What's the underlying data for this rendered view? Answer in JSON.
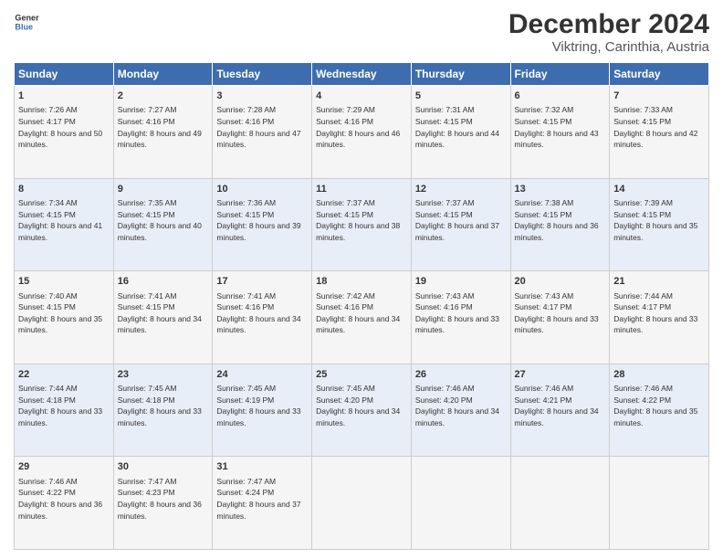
{
  "header": {
    "logo_line1": "General",
    "logo_line2": "Blue",
    "title": "December 2024",
    "subtitle": "Viktring, Carinthia, Austria"
  },
  "days_of_week": [
    "Sunday",
    "Monday",
    "Tuesday",
    "Wednesday",
    "Thursday",
    "Friday",
    "Saturday"
  ],
  "weeks": [
    [
      {
        "day": "1",
        "sunrise": "Sunrise: 7:26 AM",
        "sunset": "Sunset: 4:17 PM",
        "daylight": "Daylight: 8 hours and 50 minutes."
      },
      {
        "day": "2",
        "sunrise": "Sunrise: 7:27 AM",
        "sunset": "Sunset: 4:16 PM",
        "daylight": "Daylight: 8 hours and 49 minutes."
      },
      {
        "day": "3",
        "sunrise": "Sunrise: 7:28 AM",
        "sunset": "Sunset: 4:16 PM",
        "daylight": "Daylight: 8 hours and 47 minutes."
      },
      {
        "day": "4",
        "sunrise": "Sunrise: 7:29 AM",
        "sunset": "Sunset: 4:16 PM",
        "daylight": "Daylight: 8 hours and 46 minutes."
      },
      {
        "day": "5",
        "sunrise": "Sunrise: 7:31 AM",
        "sunset": "Sunset: 4:15 PM",
        "daylight": "Daylight: 8 hours and 44 minutes."
      },
      {
        "day": "6",
        "sunrise": "Sunrise: 7:32 AM",
        "sunset": "Sunset: 4:15 PM",
        "daylight": "Daylight: 8 hours and 43 minutes."
      },
      {
        "day": "7",
        "sunrise": "Sunrise: 7:33 AM",
        "sunset": "Sunset: 4:15 PM",
        "daylight": "Daylight: 8 hours and 42 minutes."
      }
    ],
    [
      {
        "day": "8",
        "sunrise": "Sunrise: 7:34 AM",
        "sunset": "Sunset: 4:15 PM",
        "daylight": "Daylight: 8 hours and 41 minutes."
      },
      {
        "day": "9",
        "sunrise": "Sunrise: 7:35 AM",
        "sunset": "Sunset: 4:15 PM",
        "daylight": "Daylight: 8 hours and 40 minutes."
      },
      {
        "day": "10",
        "sunrise": "Sunrise: 7:36 AM",
        "sunset": "Sunset: 4:15 PM",
        "daylight": "Daylight: 8 hours and 39 minutes."
      },
      {
        "day": "11",
        "sunrise": "Sunrise: 7:37 AM",
        "sunset": "Sunset: 4:15 PM",
        "daylight": "Daylight: 8 hours and 38 minutes."
      },
      {
        "day": "12",
        "sunrise": "Sunrise: 7:37 AM",
        "sunset": "Sunset: 4:15 PM",
        "daylight": "Daylight: 8 hours and 37 minutes."
      },
      {
        "day": "13",
        "sunrise": "Sunrise: 7:38 AM",
        "sunset": "Sunset: 4:15 PM",
        "daylight": "Daylight: 8 hours and 36 minutes."
      },
      {
        "day": "14",
        "sunrise": "Sunrise: 7:39 AM",
        "sunset": "Sunset: 4:15 PM",
        "daylight": "Daylight: 8 hours and 35 minutes."
      }
    ],
    [
      {
        "day": "15",
        "sunrise": "Sunrise: 7:40 AM",
        "sunset": "Sunset: 4:15 PM",
        "daylight": "Daylight: 8 hours and 35 minutes."
      },
      {
        "day": "16",
        "sunrise": "Sunrise: 7:41 AM",
        "sunset": "Sunset: 4:15 PM",
        "daylight": "Daylight: 8 hours and 34 minutes."
      },
      {
        "day": "17",
        "sunrise": "Sunrise: 7:41 AM",
        "sunset": "Sunset: 4:16 PM",
        "daylight": "Daylight: 8 hours and 34 minutes."
      },
      {
        "day": "18",
        "sunrise": "Sunrise: 7:42 AM",
        "sunset": "Sunset: 4:16 PM",
        "daylight": "Daylight: 8 hours and 34 minutes."
      },
      {
        "day": "19",
        "sunrise": "Sunrise: 7:43 AM",
        "sunset": "Sunset: 4:16 PM",
        "daylight": "Daylight: 8 hours and 33 minutes."
      },
      {
        "day": "20",
        "sunrise": "Sunrise: 7:43 AM",
        "sunset": "Sunset: 4:17 PM",
        "daylight": "Daylight: 8 hours and 33 minutes."
      },
      {
        "day": "21",
        "sunrise": "Sunrise: 7:44 AM",
        "sunset": "Sunset: 4:17 PM",
        "daylight": "Daylight: 8 hours and 33 minutes."
      }
    ],
    [
      {
        "day": "22",
        "sunrise": "Sunrise: 7:44 AM",
        "sunset": "Sunset: 4:18 PM",
        "daylight": "Daylight: 8 hours and 33 minutes."
      },
      {
        "day": "23",
        "sunrise": "Sunrise: 7:45 AM",
        "sunset": "Sunset: 4:18 PM",
        "daylight": "Daylight: 8 hours and 33 minutes."
      },
      {
        "day": "24",
        "sunrise": "Sunrise: 7:45 AM",
        "sunset": "Sunset: 4:19 PM",
        "daylight": "Daylight: 8 hours and 33 minutes."
      },
      {
        "day": "25",
        "sunrise": "Sunrise: 7:45 AM",
        "sunset": "Sunset: 4:20 PM",
        "daylight": "Daylight: 8 hours and 34 minutes."
      },
      {
        "day": "26",
        "sunrise": "Sunrise: 7:46 AM",
        "sunset": "Sunset: 4:20 PM",
        "daylight": "Daylight: 8 hours and 34 minutes."
      },
      {
        "day": "27",
        "sunrise": "Sunrise: 7:46 AM",
        "sunset": "Sunset: 4:21 PM",
        "daylight": "Daylight: 8 hours and 34 minutes."
      },
      {
        "day": "28",
        "sunrise": "Sunrise: 7:46 AM",
        "sunset": "Sunset: 4:22 PM",
        "daylight": "Daylight: 8 hours and 35 minutes."
      }
    ],
    [
      {
        "day": "29",
        "sunrise": "Sunrise: 7:46 AM",
        "sunset": "Sunset: 4:22 PM",
        "daylight": "Daylight: 8 hours and 36 minutes."
      },
      {
        "day": "30",
        "sunrise": "Sunrise: 7:47 AM",
        "sunset": "Sunset: 4:23 PM",
        "daylight": "Daylight: 8 hours and 36 minutes."
      },
      {
        "day": "31",
        "sunrise": "Sunrise: 7:47 AM",
        "sunset": "Sunset: 4:24 PM",
        "daylight": "Daylight: 8 hours and 37 minutes."
      },
      {
        "day": "",
        "sunrise": "",
        "sunset": "",
        "daylight": ""
      },
      {
        "day": "",
        "sunrise": "",
        "sunset": "",
        "daylight": ""
      },
      {
        "day": "",
        "sunrise": "",
        "sunset": "",
        "daylight": ""
      },
      {
        "day": "",
        "sunrise": "",
        "sunset": "",
        "daylight": ""
      }
    ]
  ]
}
